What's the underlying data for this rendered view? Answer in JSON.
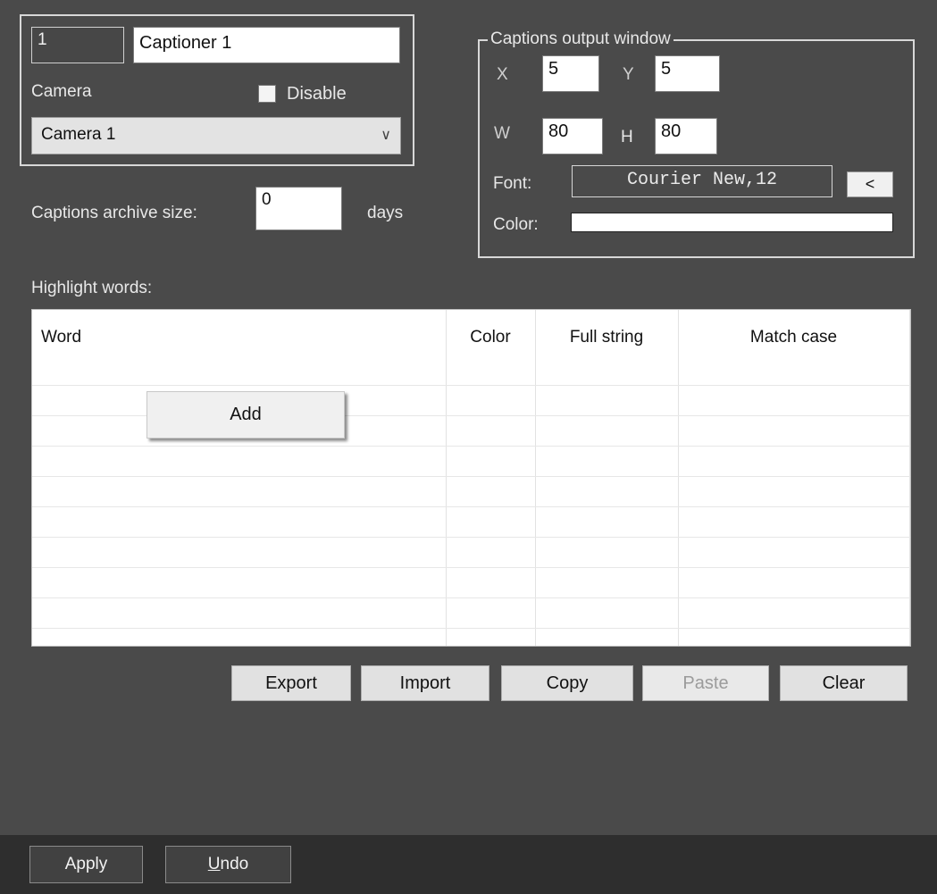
{
  "captioner": {
    "id": "1",
    "name": "Captioner 1",
    "camera_label": "Camera",
    "disable_label": "Disable",
    "disable_checked": false,
    "camera_selected": "Camera 1"
  },
  "archive": {
    "label": "Captions archive size:",
    "value": "0",
    "unit": "days"
  },
  "output_window": {
    "title": "Captions output window",
    "x_label": "X",
    "x_value": "5",
    "y_label": "Y",
    "y_value": "5",
    "w_label": "W",
    "w_value": "80",
    "h_label": "H",
    "h_value": "80",
    "font_label": "Font:",
    "font_value": "Courier New,12",
    "font_button": "<",
    "color_label": "Color:",
    "color_value": "#ffffff"
  },
  "highlight": {
    "label": "Highlight words:",
    "columns": [
      "Word",
      "Color",
      "Full string",
      "Match case"
    ],
    "rows": [],
    "context_menu": {
      "add_label": "Add"
    }
  },
  "actions": {
    "export": "Export",
    "import": "Import",
    "copy": "Copy",
    "paste": "Paste",
    "clear": "Clear"
  },
  "footer": {
    "apply": "Apply",
    "undo_underlined": "U",
    "undo_rest": "ndo"
  }
}
